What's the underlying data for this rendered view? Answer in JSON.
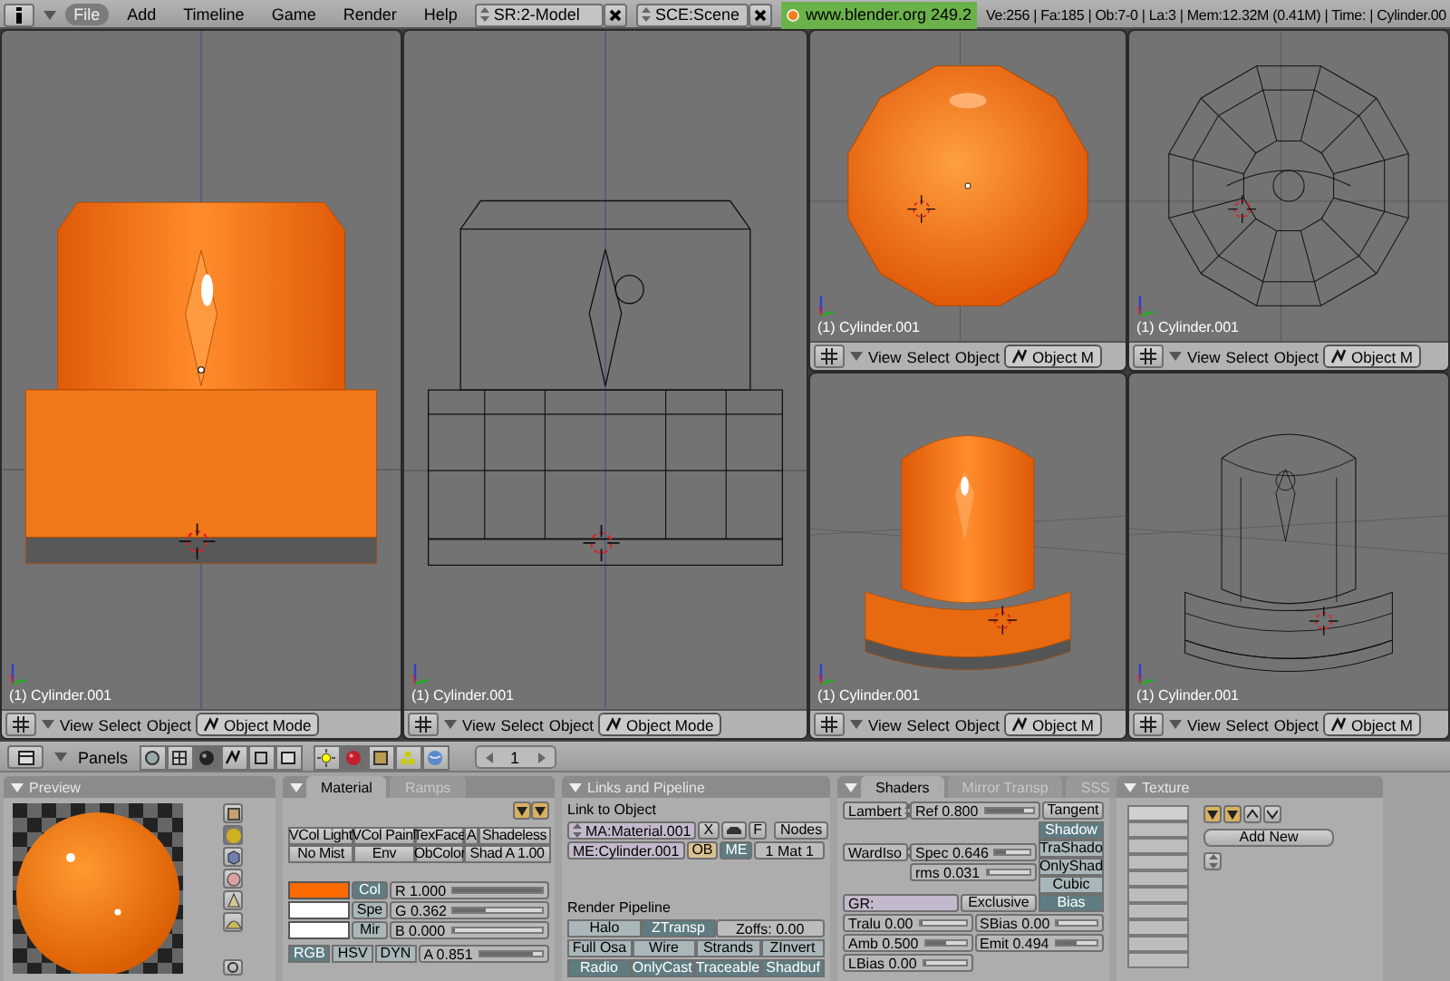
{
  "top_bar": {
    "menus": [
      {
        "label": "File",
        "selected": true
      },
      {
        "label": "Add",
        "selected": false
      },
      {
        "label": "Timeline",
        "selected": false
      },
      {
        "label": "Game",
        "selected": false
      },
      {
        "label": "Render",
        "selected": false
      },
      {
        "label": "Help",
        "selected": false
      }
    ],
    "screen": "SR:2-Model",
    "scene": "SCE:Scene",
    "version": "www.blender.org 249.2",
    "stats": "Ve:256 | Fa:185 | Ob:7-0 | La:3 | Mem:12.32M (0.41M) | Time: | Cylinder.00"
  },
  "left_viewports": [
    {
      "kind": "front-solid",
      "label": "(1) Cylinder.001",
      "menus": [
        "View",
        "Select",
        "Object"
      ],
      "mode": "Object Mode"
    },
    {
      "kind": "front-wire",
      "label": "(1) Cylinder.001",
      "menus": [
        "View",
        "Select",
        "Object"
      ],
      "mode": "Object Mode"
    }
  ],
  "right_viewports": [
    {
      "kind": "top-solid",
      "label": "(1) Cylinder.001",
      "menus": [
        "View",
        "Select",
        "Object"
      ],
      "mode": "Object M"
    },
    {
      "kind": "top-wire",
      "label": "(1) Cylinder.001",
      "menus": [
        "View",
        "Select",
        "Object"
      ],
      "mode": "Object M"
    },
    {
      "kind": "persp-solid",
      "label": "(1) Cylinder.001",
      "menus": [
        "View",
        "Select",
        "Object"
      ],
      "mode": "Object M"
    },
    {
      "kind": "persp-wire",
      "label": "(1) Cylinder.001",
      "menus": [
        "View",
        "Select",
        "Object"
      ],
      "mode": "Object M"
    }
  ],
  "buttons_header": {
    "label": "Panels",
    "context_tabs": [
      {
        "kind": "logic",
        "selected": false
      },
      {
        "kind": "script",
        "selected": false
      },
      {
        "kind": "shading",
        "selected": true
      },
      {
        "kind": "object",
        "selected": false
      },
      {
        "kind": "editing",
        "selected": false
      },
      {
        "kind": "scene",
        "selected": false
      }
    ],
    "sub_tabs": [
      {
        "kind": "lamp",
        "selected": false
      },
      {
        "kind": "material",
        "selected": true
      },
      {
        "kind": "texture",
        "selected": false
      },
      {
        "kind": "radiosity",
        "selected": false
      },
      {
        "kind": "world",
        "selected": false
      }
    ],
    "frame": "1"
  },
  "preview": {
    "title": "Preview",
    "shapes": [
      {
        "kind": "plane",
        "selected": false
      },
      {
        "kind": "sphere",
        "selected": true
      },
      {
        "kind": "cube",
        "selected": false
      },
      {
        "kind": "monkey",
        "selected": false
      },
      {
        "kind": "hair",
        "selected": false
      },
      {
        "kind": "sky",
        "selected": false
      }
    ]
  },
  "material": {
    "tabs": [
      {
        "label": "Material",
        "selected": true
      },
      {
        "label": "Ramps",
        "selected": false
      }
    ],
    "buttons": [
      "VCol Light",
      "VCol Paint",
      "TexFace",
      "A",
      "Shadeless",
      "No Mist",
      "Env",
      "ObColor",
      "Shad A 1.00"
    ],
    "colors": [
      {
        "label": "Col",
        "color": "#ff6a00",
        "selected": true
      },
      {
        "label": "Spe",
        "color": "#ffffff",
        "selected": false
      },
      {
        "label": "Mir",
        "color": "#ffffff",
        "selected": false
      }
    ],
    "sliders": [
      {
        "label": "R 1.000",
        "level": 1
      },
      {
        "label": "G 0.362",
        "level": 0.362
      },
      {
        "label": "B 0.000",
        "level": 0
      }
    ],
    "color_modes": [
      {
        "label": "RGB",
        "selected": true
      },
      {
        "label": "HSV",
        "selected": false
      },
      {
        "label": "DYN",
        "selected": false
      }
    ],
    "alpha": {
      "label": "A 0.851",
      "level": 0.851
    }
  },
  "links": {
    "title": "Links and Pipeline",
    "link_label": "Link to Object",
    "material_field": "MA:Material.001",
    "delete": "X",
    "fake": "F",
    "nodes": "Nodes",
    "mesh_field": "ME:Cylinder.001",
    "link_to": [
      {
        "label": "OB",
        "selected": false
      },
      {
        "label": "ME",
        "selected": true
      }
    ],
    "mat_index": "1 Mat 1",
    "pipeline_label": "Render Pipeline",
    "pipeline_rows": [
      {
        "items": [
          {
            "kind": "toggle",
            "label": "Halo",
            "on": false
          },
          {
            "kind": "toggle",
            "label": "ZTransp",
            "on": true
          },
          {
            "kind": "number",
            "label": "Zoffs: 0.00"
          }
        ]
      },
      {
        "items": [
          {
            "kind": "toggle",
            "label": "Full Osa",
            "on": false
          },
          {
            "kind": "toggle",
            "label": "Wire",
            "on": false
          },
          {
            "kind": "toggle",
            "label": "Strands",
            "on": false
          },
          {
            "kind": "toggle",
            "label": "ZInvert",
            "on": false
          }
        ]
      },
      {
        "items": [
          {
            "kind": "toggle",
            "label": "Radio",
            "on": true
          },
          {
            "kind": "toggle",
            "label": "OnlyCast",
            "on": true
          },
          {
            "kind": "toggle",
            "label": "Traceable",
            "on": true
          },
          {
            "kind": "toggle",
            "label": "Shadbuf",
            "on": true
          }
        ]
      }
    ]
  },
  "shaders": {
    "tabs": [
      {
        "label": "Shaders",
        "selected": true
      },
      {
        "label": "Mirror Transp",
        "selected": false
      },
      {
        "label": "SSS",
        "selected": false
      }
    ],
    "diffuse": "Lambert",
    "ref": {
      "label": "Ref 0.800",
      "level": 0.8
    },
    "tangent": "Tangent",
    "specular": "WardIso",
    "spec": {
      "label": "Spec 0.646",
      "level": 0.32
    },
    "rms": {
      "label": "rms 0.031",
      "level": 0.08
    },
    "toggles": [
      {
        "label": "Shadow",
        "on": true
      },
      {
        "label": "TraShado",
        "on": false
      },
      {
        "label": "OnlyShad",
        "on": false
      },
      {
        "label": "Cubic",
        "on": false
      },
      {
        "label": "Bias",
        "on": true
      }
    ],
    "group_field": "GR:",
    "exclusive": "Exclusive",
    "sliders": [
      {
        "label": "Tralu 0.00",
        "level": 0
      },
      {
        "label": "SBias 0.00",
        "level": 0
      },
      {
        "label": "Amb 0.500",
        "level": 0.5
      },
      {
        "label": "Emit 0.494",
        "level": 0.494
      },
      {
        "label": "LBias 0.00",
        "level": 0
      }
    ]
  },
  "texture": {
    "title": "Texture",
    "add_new": "Add New"
  }
}
